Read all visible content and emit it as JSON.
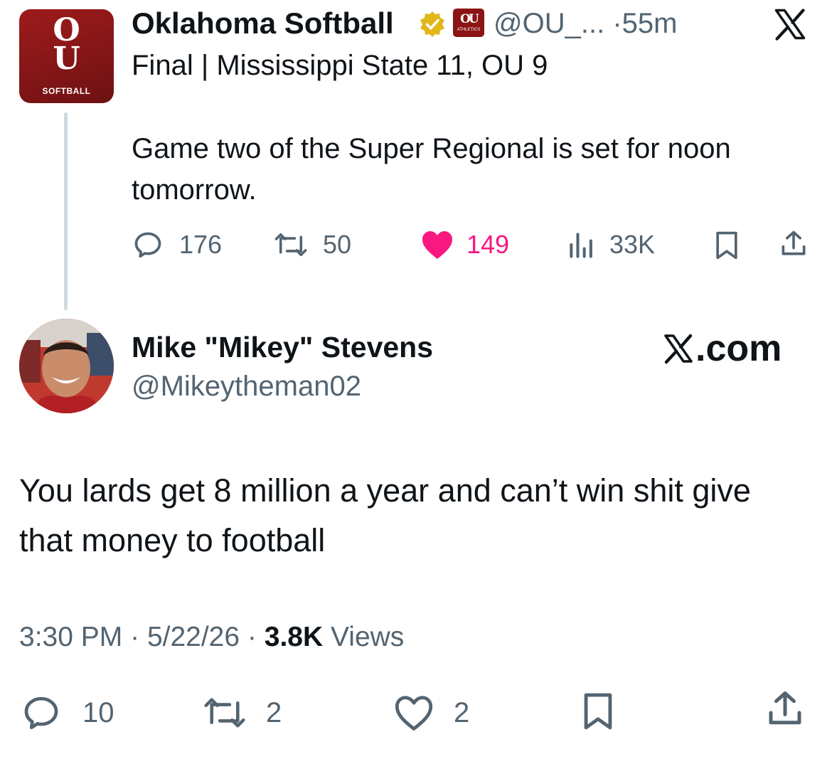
{
  "tweet1": {
    "avatar_text": "SOFTBALL",
    "name": "Oklahoma Softball",
    "affiliate_badge_text": "ATHLETICS",
    "handle": "@OU_...",
    "separator": "·",
    "time": "55m",
    "line1": "Final | Mississippi State 11, OU 9",
    "body": "Game two of the Super Regional is set for noon tomorrow.",
    "actions": {
      "replies": "176",
      "reposts": "50",
      "likes": "149",
      "views": "33K"
    },
    "like_color": "#f91880"
  },
  "tweet2": {
    "name": "Mike \"Mikey\" Stevens",
    "handle": "@Mikeytheman02",
    "watermark": ".com",
    "body": "You lards get 8 million a year and can’t win shit give that money to football",
    "meta": {
      "time": "3:30 PM",
      "sep1": "·",
      "date": "5/22/26",
      "sep2": "·",
      "views_count": "3.8K",
      "views_label": "Views"
    },
    "actions": {
      "replies": "10",
      "reposts": "2",
      "likes": "2"
    }
  },
  "colors": {
    "text": "#0f1419",
    "secondary": "#536471",
    "ou_crimson": "#841617",
    "verified_gold": "#e2b719",
    "thread_line": "#cfd9de"
  }
}
